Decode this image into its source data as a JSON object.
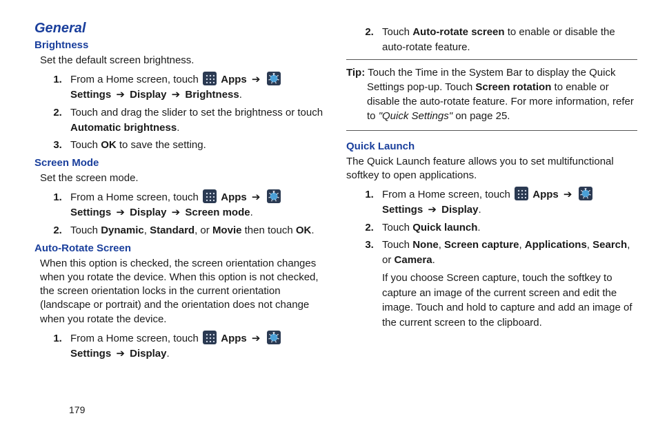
{
  "page_number": "179",
  "left": {
    "h1": "General",
    "sec1": {
      "title": "Brightness",
      "intro": "Set the default screen brightness.",
      "s1a": "From a Home screen, touch ",
      "apps": "Apps",
      "settings": "Settings",
      "s1b_display": "Display",
      "s1b_brightness": "Brightness",
      "s2a": "Touch and drag the slider to set the brightness or touch ",
      "s2b": "Automatic brightness",
      "s3a": "Touch ",
      "s3b": "OK",
      "s3c": " to save the setting."
    },
    "sec2": {
      "title": "Screen Mode",
      "intro": "Set the screen mode.",
      "s1a": "From a Home screen, touch ",
      "apps": "Apps",
      "settings": "Settings",
      "s1b_display": "Display",
      "s1b_mode": "Screen mode",
      "s2a": "Touch ",
      "s2b": "Dynamic",
      "s2c": "Standard",
      "s2d": "Movie",
      "s2e": " then touch ",
      "s2f": "OK"
    },
    "sec3": {
      "title": "Auto-Rotate Screen",
      "intro": "When this option is checked, the screen orientation changes when you rotate the device. When this option is not checked, the screen orientation locks in the current orientation (landscape or portrait) and the orientation does not change when you rotate the device.",
      "s1a": "From a Home screen, touch ",
      "apps": "Apps",
      "settings": "Settings",
      "s1b_display": "Display"
    }
  },
  "right": {
    "cont": {
      "s2a": "Touch ",
      "s2b": "Auto-rotate screen",
      "s2c": " to enable or disable the auto-rotate feature."
    },
    "tip": {
      "label": "Tip:",
      "t1": " Touch the Time in the System Bar to display the Quick Settings pop-up. Touch ",
      "t2": "Screen rotation",
      "t3": " to enable or disable the auto-rotate feature. For more information, refer to ",
      "t4": "\"Quick Settings\"",
      "t5": " on page 25."
    },
    "sec4": {
      "title": "Quick Launch",
      "intro": "The Quick Launch feature allows you to set multifunctional softkey to open applications.",
      "s1a": "From a Home screen, touch ",
      "apps": "Apps",
      "settings": "Settings",
      "s1b_display": "Display",
      "s2a": "Touch ",
      "s2b": "Quick launch",
      "s3a": "Touch ",
      "s3b": "None",
      "s3c": "Screen capture",
      "s3d": "Applications",
      "s3e": "Search",
      "s3f": "Camera",
      "s3sub": "If you choose Screen capture, touch the softkey to capture an image of the current screen and edit the image. Touch and hold to capture and add an image of the current screen to the clipboard."
    }
  }
}
